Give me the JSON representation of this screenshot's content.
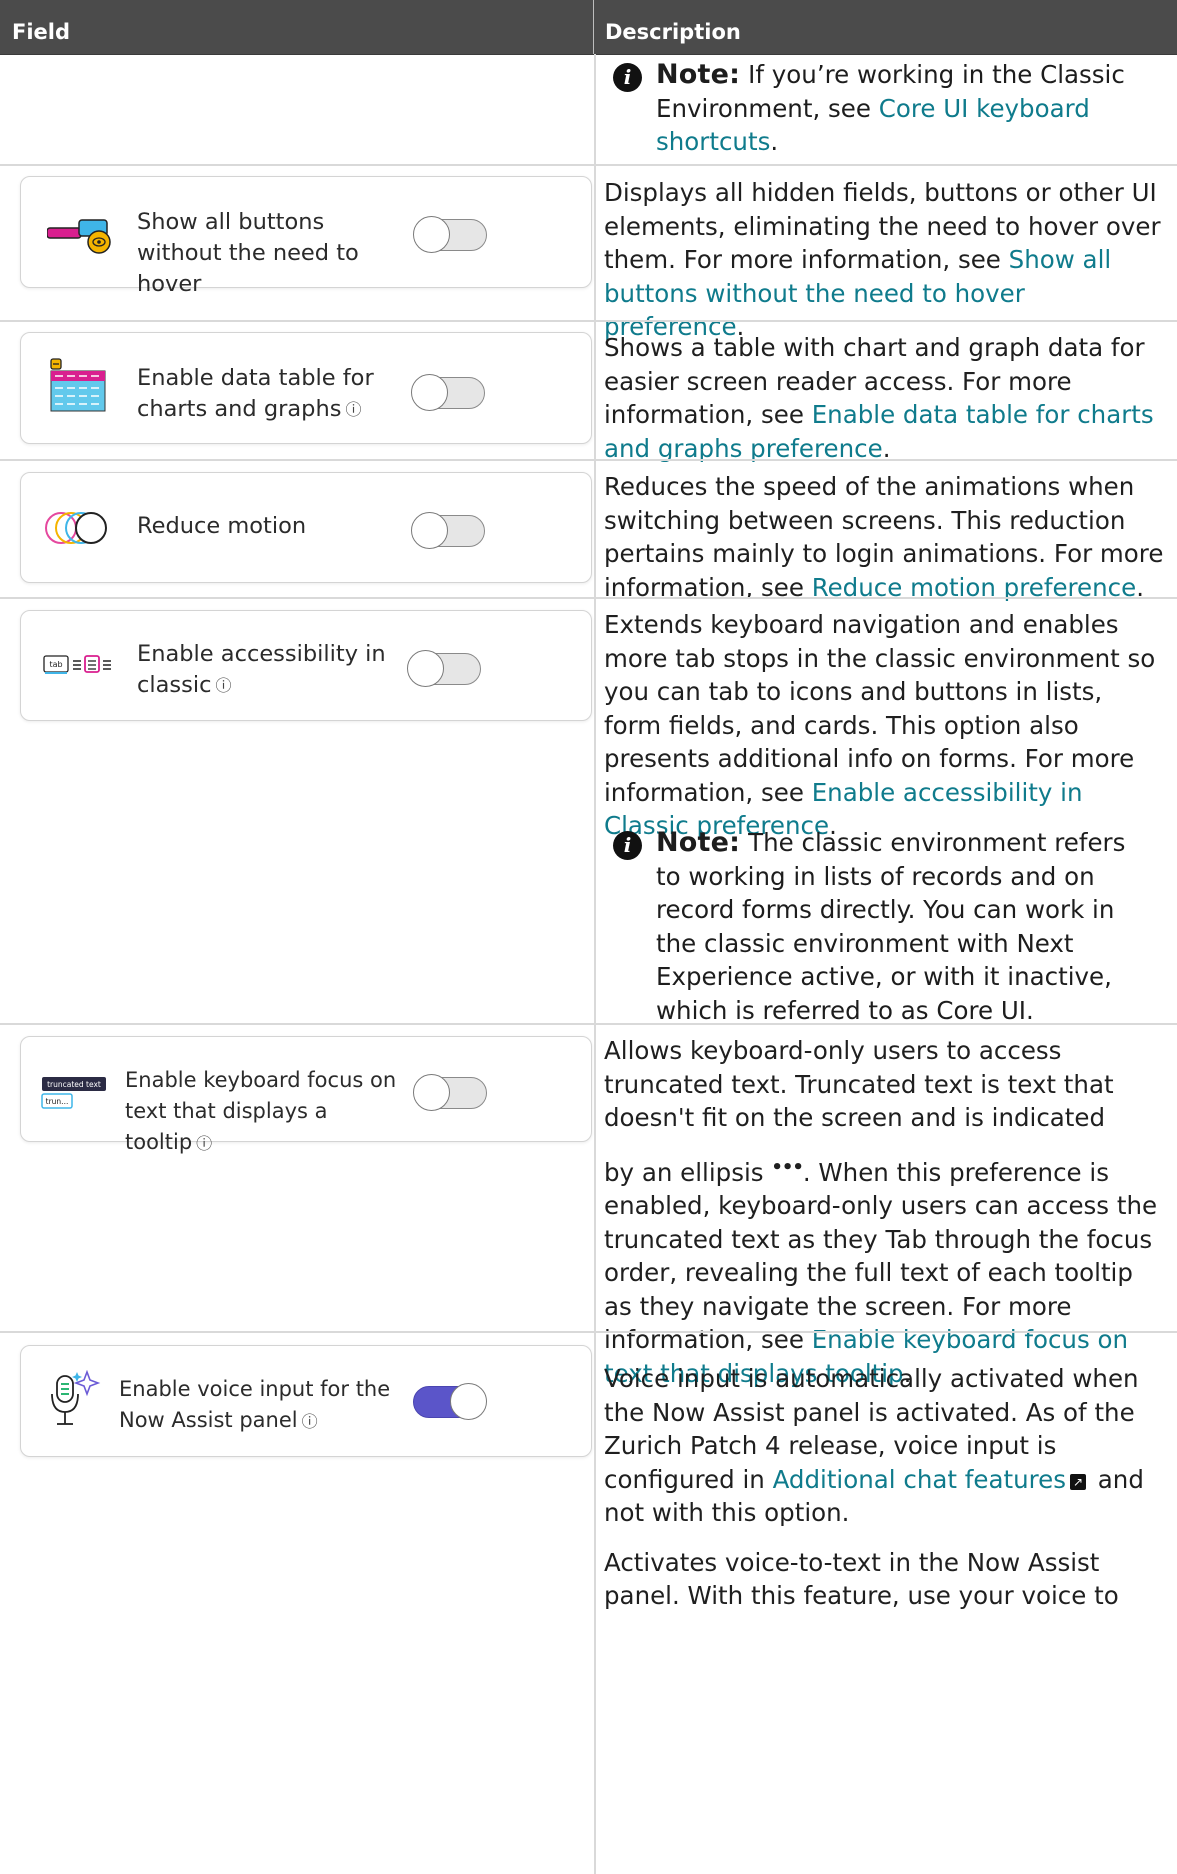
{
  "table": {
    "header_field": "Field",
    "header_description": "Description"
  },
  "rows": [
    {
      "note_label": "Note:",
      "note_text_before": "If you’re working in the Classic Environment, see ",
      "note_link": "Core UI keyboard shortcuts",
      "note_text_after": "."
    },
    {
      "card_label": "Show all buttons without the need to hover",
      "toggle_on": false,
      "desc_before": "Displays all hidden fields, buttons or other UI elements, eliminating the need to hover over them. For more information, see ",
      "desc_link": "Show all buttons without the need to hover preference",
      "desc_after": "."
    },
    {
      "card_label": "Enable data table for charts and graphs",
      "info_icon": true,
      "toggle_on": false,
      "desc_before": "Shows a table with chart and graph data for easier screen reader access. For more information, see ",
      "desc_link": "Enable data table for charts and graphs preference",
      "desc_after": "."
    },
    {
      "card_label": "Reduce motion",
      "toggle_on": false,
      "desc_before": "Reduces the speed of the animations when switching between screens. This reduction pertains mainly to login animations. For more information, see ",
      "desc_link": "Reduce motion preference",
      "desc_after": "."
    },
    {
      "card_label": "Enable accessibility in classic",
      "icon_text": "tab",
      "info_icon": true,
      "toggle_on": false,
      "desc_before": "Extends keyboard navigation and enables more tab stops in the classic environment so you can tab to icons and buttons in lists, form fields, and cards. This option also presents additional info on forms. For more information, see ",
      "desc_link": "Enable accessibility in Classic preference",
      "desc_after": ".",
      "note_label": "Note:",
      "note_text": "The classic environment refers to working in lists of records and on record forms directly. You can work in the classic environment with Next Experience active, or with it inactive, which is referred to as Core UI."
    },
    {
      "card_label": "Enable keyboard focus on text that displays a tooltip",
      "icon_text_1": "truncated text",
      "icon_text_2": "trun...",
      "info_icon": true,
      "toggle_on": false,
      "desc_part1": "Allows keyboard-only users to access truncated text. Truncated text is text that doesn't fit on the screen and is indicated",
      "desc_part2_before": "by an ellipsis ",
      "ellipsis": "•••",
      "desc_part2_after": ". When this preference is enabled, keyboard-only users can access the truncated text as they Tab through the focus order, revealing the full text of each tooltip as they navigate the screen. For more information, see ",
      "desc_link": "Enable keyboard focus on text that displays tooltip",
      "desc_after": "."
    },
    {
      "card_label": "Enable voice input for the Now Assist panel",
      "info_icon": true,
      "toggle_on": true,
      "desc1_before": "Voice input is automatically activated when the Now Assist panel is activated. As of the Zurich Patch 4 release, voice input is configured in ",
      "desc1_link": "Additional chat features",
      "desc1_after": " and not with this option.",
      "desc2": "Activates voice-to-text in the Now Assist panel. With this feature, use your voice to"
    }
  ]
}
